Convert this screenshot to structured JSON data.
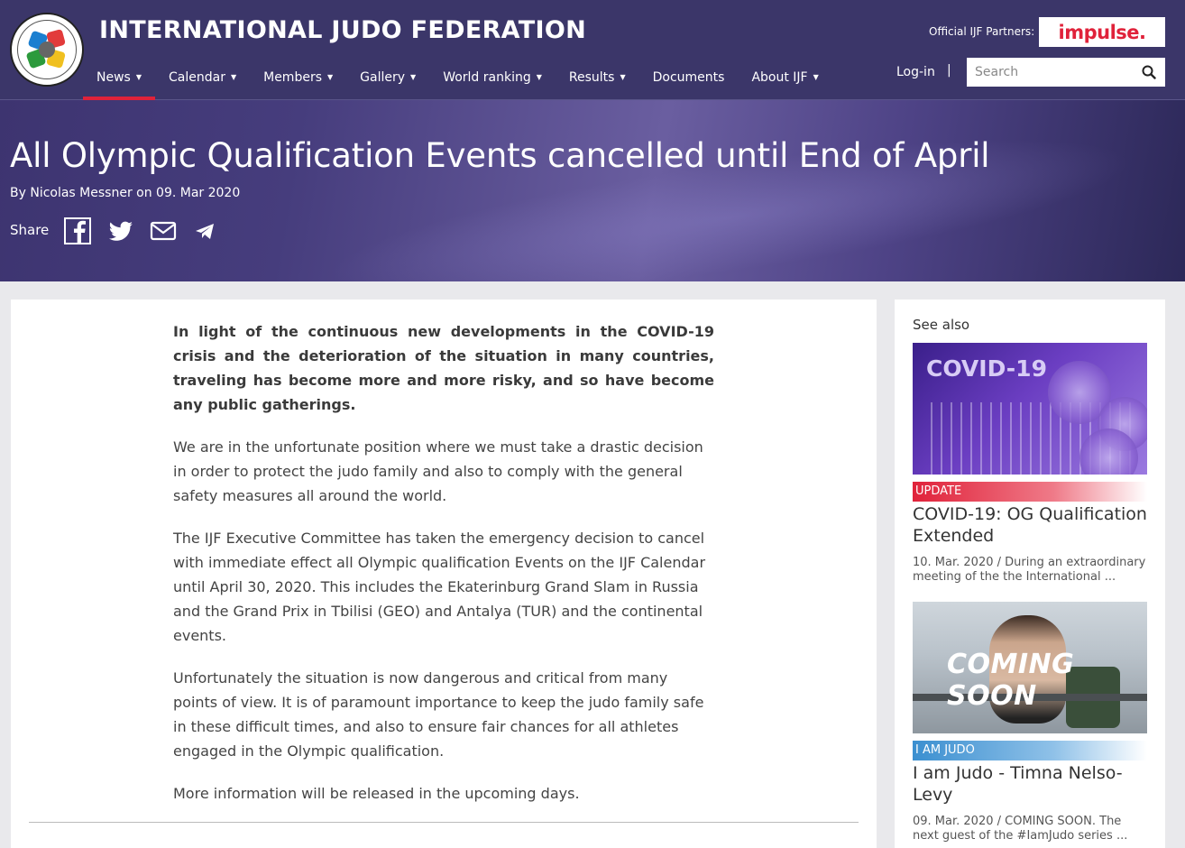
{
  "header": {
    "site_title": "INTERNATIONAL JUDO FEDERATION",
    "partners_label": "Official IJF Partners:",
    "partner_name": "impulse.",
    "nav": [
      {
        "label": "News",
        "caret": "▼"
      },
      {
        "label": "Calendar",
        "caret": "▼"
      },
      {
        "label": "Members",
        "caret": "▼"
      },
      {
        "label": "Gallery",
        "caret": "▼"
      },
      {
        "label": "World ranking",
        "caret": "▼"
      },
      {
        "label": "Results",
        "caret": "▼"
      },
      {
        "label": "Documents"
      },
      {
        "label": "About IJF",
        "caret": "▼"
      }
    ],
    "login": "Log-in",
    "separator": "|",
    "search_placeholder": "Search",
    "accent_color": "#e0223a"
  },
  "article": {
    "title": "All Olympic Qualification Events cancelled until End of April",
    "byline": "By Nicolas Messner on 09. Mar 2020",
    "share_label": "Share",
    "share_icons": [
      "facebook-icon",
      "twitter-icon",
      "email-icon",
      "telegram-icon"
    ],
    "paragraphs": [
      "In light of the continuous new developments in the COVID-19 crisis and the deterioration of the situation in many countries, traveling has become more and more risky, and so have become any public gatherings.",
      "We are in the unfortunate position where we must take a drastic decision in order to protect the judo family and also to comply with the general safety measures all around the world.",
      "The IJF Executive Committee has taken the emergency decision to cancel with immediate effect all Olympic qualification Events on the IJF Calendar until April 30, 2020. This includes the Ekaterinburg Grand Slam in Russia and the Grand Prix in Tbilisi (GEO) and Antalya (TUR) and the continental events.",
      "Unfortunately the situation is now dangerous and critical from many points of view. It is of paramount importance to keep the judo family safe in these difficult times, and also to ensure fair chances for all athletes engaged in the Olympic qualification.",
      "More information will be released in the upcoming days."
    ]
  },
  "sidebar": {
    "heading": "See also",
    "cards": [
      {
        "image_text": "COVID-19",
        "tag": "UPDATE",
        "title": "COVID-19: OG Qualification Extended",
        "excerpt": "10. Mar. 2020 / During an extraordinary meeting of the the International ..."
      },
      {
        "image_text": "COMING SOON",
        "tag": "I AM JUDO",
        "title": "I am Judo - Timna Nelso-Levy",
        "excerpt": "09. Mar. 2020 / COMING SOON. The next guest of the #IamJudo series ..."
      }
    ]
  }
}
